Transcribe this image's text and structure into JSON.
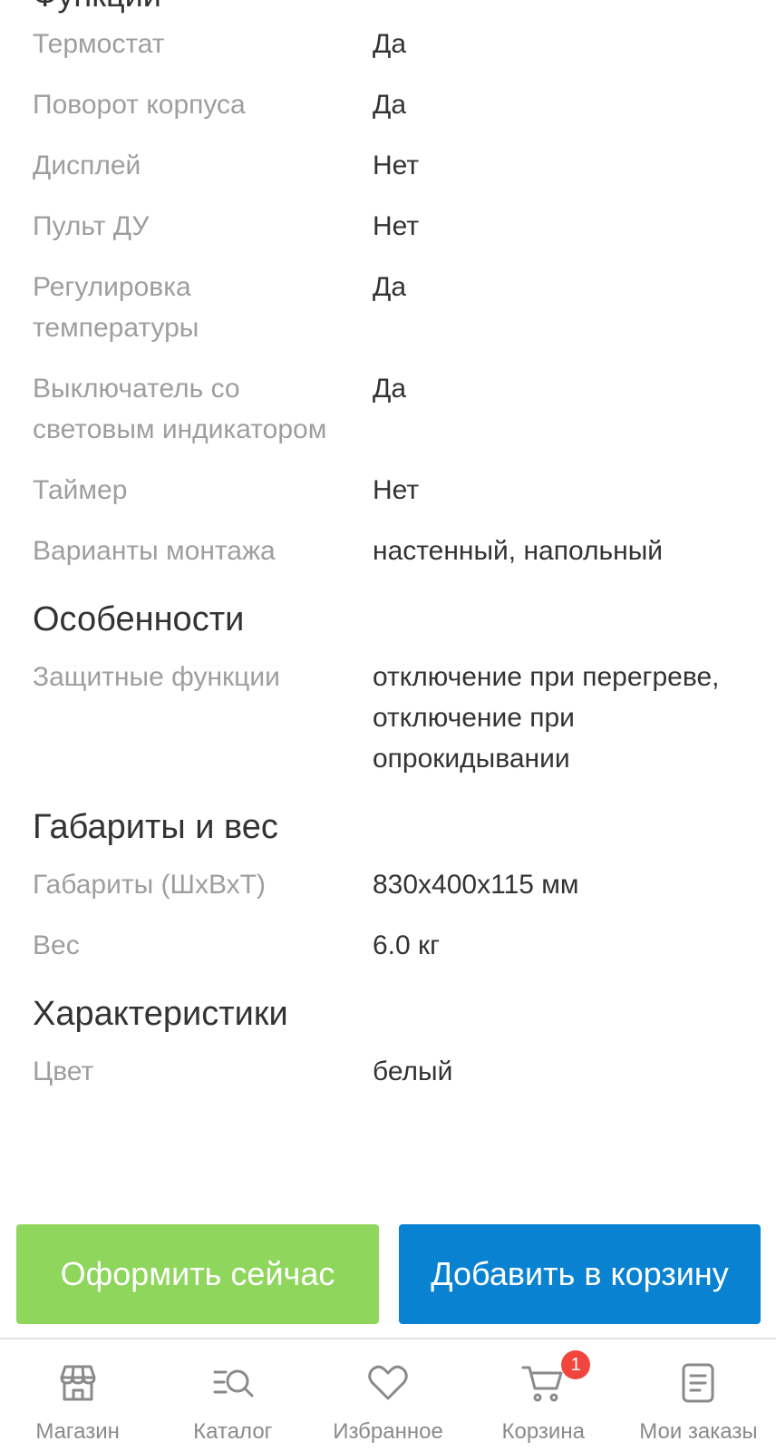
{
  "specs": {
    "cut_heading": "Функции",
    "rows_a": [
      {
        "key": "Термостат",
        "value": "Да"
      },
      {
        "key": "Поворот корпуса",
        "value": "Да"
      },
      {
        "key": "Дисплей",
        "value": "Нет"
      },
      {
        "key": "Пульт ДУ",
        "value": "Нет"
      },
      {
        "key": "Регулировка температуры",
        "value": "Да"
      },
      {
        "key": "Выключатель со световым индикатором",
        "value": "Да"
      },
      {
        "key": "Таймер",
        "value": "Нет"
      },
      {
        "key": "Варианты монтажа",
        "value": "настенный, напольный"
      }
    ],
    "section_features": "Особенности",
    "rows_b": [
      {
        "key": "Защитные функции",
        "value": "отключение при перегреве, отключение при опрокидывании"
      }
    ],
    "section_dimensions": "Габариты и вес",
    "rows_c": [
      {
        "key": "Габариты (ШхВхТ)",
        "value": "830x400x115 мм"
      },
      {
        "key": "Вес",
        "value": "6.0 кг"
      }
    ],
    "section_characteristics": "Характеристики",
    "rows_d": [
      {
        "key": "Цвет",
        "value": "белый"
      }
    ]
  },
  "actions": {
    "buy_now": "Оформить сейчас",
    "add_to_cart": "Добавить в корзину"
  },
  "nav": {
    "items": [
      {
        "label": "Магазин",
        "icon": "store-icon"
      },
      {
        "label": "Каталог",
        "icon": "catalog-search-icon"
      },
      {
        "label": "Избранное",
        "icon": "heart-icon"
      },
      {
        "label": "Корзина",
        "icon": "cart-icon",
        "badge": "1"
      },
      {
        "label": "Мои заказы",
        "icon": "orders-icon"
      }
    ]
  },
  "colors": {
    "buy_button": "#8fd65c",
    "cart_button": "#0a82d2",
    "badge": "#f2453d"
  }
}
